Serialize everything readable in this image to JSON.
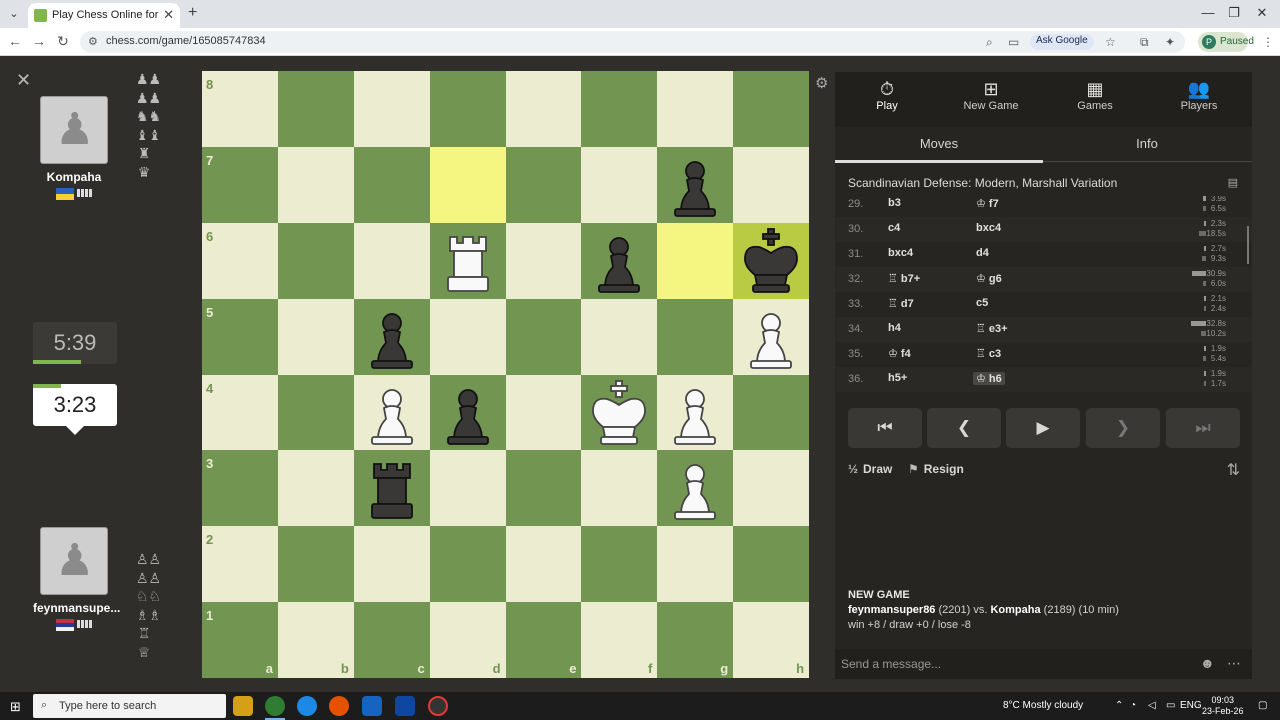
{
  "browser": {
    "tab_title": "Play Chess Online for FREE - 2 P",
    "url": "chess.com/game/165085747834",
    "ask_google": "Ask Google",
    "profile_initial": "P",
    "profile_status": "Paused"
  },
  "opponent": {
    "name": "Kompaha",
    "clock": "5:39",
    "country": "Ukraine"
  },
  "self": {
    "name": "feynmansupe...",
    "clock": "3:23",
    "country": "Serbia"
  },
  "panel": {
    "tabs": [
      {
        "label": "Play",
        "icon": "stopwatch-icon"
      },
      {
        "label": "New Game",
        "icon": "plus-icon"
      },
      {
        "label": "Games",
        "icon": "board-icon"
      },
      {
        "label": "Players",
        "icon": "people-icon"
      }
    ],
    "subtabs": [
      "Moves",
      "Info"
    ],
    "opening": "Scandinavian Defense: Modern, Marshall Variation",
    "moves": [
      {
        "num": "29.",
        "white": "b3",
        "black": "♔ f7",
        "t1": "3.9s",
        "t2": "6.5s",
        "w1": 3,
        "w2": 3
      },
      {
        "num": "30.",
        "white": "c4",
        "black": "bxc4",
        "t1": "2.3s",
        "t2": "18.5s",
        "w1": 2,
        "w2": 7
      },
      {
        "num": "31.",
        "white": "bxc4",
        "black": "d4",
        "t1": "2.7s",
        "t2": "9.3s",
        "w1": 2,
        "w2": 4
      },
      {
        "num": "32.",
        "white": "♖ b7+",
        "black": "♔ g6",
        "t1": "30.9s",
        "t2": "6.0s",
        "w1": 14,
        "w2": 3
      },
      {
        "num": "33.",
        "white": "♖ d7",
        "black": "c5",
        "t1": "2.1s",
        "t2": "2.4s",
        "w1": 2,
        "w2": 2
      },
      {
        "num": "34.",
        "white": "h4",
        "black": "♖ e3+",
        "t1": "32.8s",
        "t2": "10.2s",
        "w1": 15,
        "w2": 5
      },
      {
        "num": "35.",
        "white": "♔ f4",
        "black": "♖ c3",
        "t1": "1.9s",
        "t2": "5.4s",
        "w1": 2,
        "w2": 3
      },
      {
        "num": "36.",
        "white": "h5+",
        "black": "♔ h6",
        "t1": "1.9s",
        "t2": "1.7s",
        "w1": 2,
        "w2": 2
      }
    ],
    "draw_label": "Draw",
    "resign_label": "Resign",
    "new_game": {
      "title": "NEW GAME",
      "white": "feynmansuper86",
      "white_rating": "(2201)",
      "vs": "vs.",
      "black": "Kompaha",
      "black_rating": "(2189)",
      "time_control": "(10 min)",
      "outcomes": "win +8 / draw +0 / lose -8"
    },
    "message_placeholder": "Send a message..."
  },
  "board": {
    "files": [
      "a",
      "b",
      "c",
      "d",
      "e",
      "f",
      "g",
      "h"
    ],
    "ranks": [
      "8",
      "7",
      "6",
      "5",
      "4",
      "3",
      "2",
      "1"
    ],
    "highlights": [
      "d7",
      "g6",
      "h6"
    ],
    "pieces": [
      {
        "square": "g7",
        "type": "pawn",
        "color": "black"
      },
      {
        "square": "d6",
        "type": "rook",
        "color": "white"
      },
      {
        "square": "f6",
        "type": "pawn",
        "color": "black"
      },
      {
        "square": "h6",
        "type": "king",
        "color": "black"
      },
      {
        "square": "c5",
        "type": "pawn",
        "color": "black"
      },
      {
        "square": "h5",
        "type": "pawn",
        "color": "white"
      },
      {
        "square": "c4",
        "type": "pawn",
        "color": "white"
      },
      {
        "square": "d4",
        "type": "pawn",
        "color": "black"
      },
      {
        "square": "f4",
        "type": "king",
        "color": "white"
      },
      {
        "square": "g4",
        "type": "pawn",
        "color": "white"
      },
      {
        "square": "c3",
        "type": "rook",
        "color": "black"
      },
      {
        "square": "g3",
        "type": "pawn",
        "color": "white"
      }
    ]
  },
  "captured_opp": [
    "♟♟",
    "♟♟",
    "♞♞",
    "♝♝",
    "♜",
    "♛"
  ],
  "captured_self": [
    "♙♙",
    "♙♙",
    "♘♘",
    "♗♗",
    "♖",
    "♕"
  ],
  "taskbar": {
    "search_placeholder": "Type here to search",
    "weather": "8°C  Mostly cloudy",
    "lang": "ENG",
    "time": "09:03",
    "date": "23-Feb-26"
  }
}
